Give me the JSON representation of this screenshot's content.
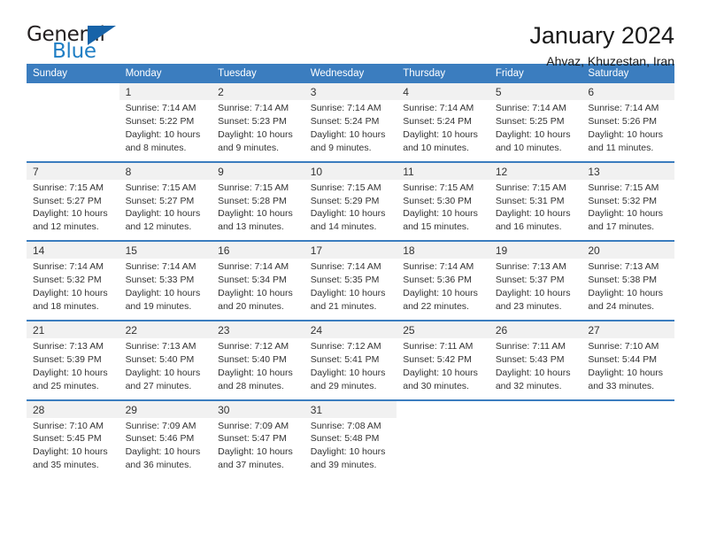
{
  "brand": {
    "name_part1": "General",
    "name_part2": "Blue",
    "triangle_icon": "triangle-icon",
    "primary_color": "#1763a8",
    "text_color": "#231f20"
  },
  "header": {
    "title": "January 2024",
    "subtitle": "Ahvaz, Khuzestan, Iran"
  },
  "theme": {
    "header_bar_color": "#3b7dbf",
    "daynum_band_color": "#f1f1f1",
    "separator_color": "#3b7dbf",
    "text_color": "#333333"
  },
  "weekday_headers": [
    "Sunday",
    "Monday",
    "Tuesday",
    "Wednesday",
    "Thursday",
    "Friday",
    "Saturday"
  ],
  "labels": {
    "sunrise_prefix": "Sunrise:",
    "sunset_prefix": "Sunset:",
    "daylight_prefix": "Daylight:"
  },
  "weeks": [
    {
      "days": [
        {
          "day": "",
          "sunrise": "",
          "sunset": "",
          "daylight_line1": "",
          "daylight_line2": "",
          "empty": true
        },
        {
          "day": "1",
          "sunrise": "Sunrise: 7:14 AM",
          "sunset": "Sunset: 5:22 PM",
          "daylight_line1": "Daylight: 10 hours",
          "daylight_line2": "and 8 minutes."
        },
        {
          "day": "2",
          "sunrise": "Sunrise: 7:14 AM",
          "sunset": "Sunset: 5:23 PM",
          "daylight_line1": "Daylight: 10 hours",
          "daylight_line2": "and 9 minutes."
        },
        {
          "day": "3",
          "sunrise": "Sunrise: 7:14 AM",
          "sunset": "Sunset: 5:24 PM",
          "daylight_line1": "Daylight: 10 hours",
          "daylight_line2": "and 9 minutes."
        },
        {
          "day": "4",
          "sunrise": "Sunrise: 7:14 AM",
          "sunset": "Sunset: 5:24 PM",
          "daylight_line1": "Daylight: 10 hours",
          "daylight_line2": "and 10 minutes."
        },
        {
          "day": "5",
          "sunrise": "Sunrise: 7:14 AM",
          "sunset": "Sunset: 5:25 PM",
          "daylight_line1": "Daylight: 10 hours",
          "daylight_line2": "and 10 minutes."
        },
        {
          "day": "6",
          "sunrise": "Sunrise: 7:14 AM",
          "sunset": "Sunset: 5:26 PM",
          "daylight_line1": "Daylight: 10 hours",
          "daylight_line2": "and 11 minutes."
        }
      ]
    },
    {
      "days": [
        {
          "day": "7",
          "sunrise": "Sunrise: 7:15 AM",
          "sunset": "Sunset: 5:27 PM",
          "daylight_line1": "Daylight: 10 hours",
          "daylight_line2": "and 12 minutes."
        },
        {
          "day": "8",
          "sunrise": "Sunrise: 7:15 AM",
          "sunset": "Sunset: 5:27 PM",
          "daylight_line1": "Daylight: 10 hours",
          "daylight_line2": "and 12 minutes."
        },
        {
          "day": "9",
          "sunrise": "Sunrise: 7:15 AM",
          "sunset": "Sunset: 5:28 PM",
          "daylight_line1": "Daylight: 10 hours",
          "daylight_line2": "and 13 minutes."
        },
        {
          "day": "10",
          "sunrise": "Sunrise: 7:15 AM",
          "sunset": "Sunset: 5:29 PM",
          "daylight_line1": "Daylight: 10 hours",
          "daylight_line2": "and 14 minutes."
        },
        {
          "day": "11",
          "sunrise": "Sunrise: 7:15 AM",
          "sunset": "Sunset: 5:30 PM",
          "daylight_line1": "Daylight: 10 hours",
          "daylight_line2": "and 15 minutes."
        },
        {
          "day": "12",
          "sunrise": "Sunrise: 7:15 AM",
          "sunset": "Sunset: 5:31 PM",
          "daylight_line1": "Daylight: 10 hours",
          "daylight_line2": "and 16 minutes."
        },
        {
          "day": "13",
          "sunrise": "Sunrise: 7:15 AM",
          "sunset": "Sunset: 5:32 PM",
          "daylight_line1": "Daylight: 10 hours",
          "daylight_line2": "and 17 minutes."
        }
      ]
    },
    {
      "days": [
        {
          "day": "14",
          "sunrise": "Sunrise: 7:14 AM",
          "sunset": "Sunset: 5:32 PM",
          "daylight_line1": "Daylight: 10 hours",
          "daylight_line2": "and 18 minutes."
        },
        {
          "day": "15",
          "sunrise": "Sunrise: 7:14 AM",
          "sunset": "Sunset: 5:33 PM",
          "daylight_line1": "Daylight: 10 hours",
          "daylight_line2": "and 19 minutes."
        },
        {
          "day": "16",
          "sunrise": "Sunrise: 7:14 AM",
          "sunset": "Sunset: 5:34 PM",
          "daylight_line1": "Daylight: 10 hours",
          "daylight_line2": "and 20 minutes."
        },
        {
          "day": "17",
          "sunrise": "Sunrise: 7:14 AM",
          "sunset": "Sunset: 5:35 PM",
          "daylight_line1": "Daylight: 10 hours",
          "daylight_line2": "and 21 minutes."
        },
        {
          "day": "18",
          "sunrise": "Sunrise: 7:14 AM",
          "sunset": "Sunset: 5:36 PM",
          "daylight_line1": "Daylight: 10 hours",
          "daylight_line2": "and 22 minutes."
        },
        {
          "day": "19",
          "sunrise": "Sunrise: 7:13 AM",
          "sunset": "Sunset: 5:37 PM",
          "daylight_line1": "Daylight: 10 hours",
          "daylight_line2": "and 23 minutes."
        },
        {
          "day": "20",
          "sunrise": "Sunrise: 7:13 AM",
          "sunset": "Sunset: 5:38 PM",
          "daylight_line1": "Daylight: 10 hours",
          "daylight_line2": "and 24 minutes."
        }
      ]
    },
    {
      "days": [
        {
          "day": "21",
          "sunrise": "Sunrise: 7:13 AM",
          "sunset": "Sunset: 5:39 PM",
          "daylight_line1": "Daylight: 10 hours",
          "daylight_line2": "and 25 minutes."
        },
        {
          "day": "22",
          "sunrise": "Sunrise: 7:13 AM",
          "sunset": "Sunset: 5:40 PM",
          "daylight_line1": "Daylight: 10 hours",
          "daylight_line2": "and 27 minutes."
        },
        {
          "day": "23",
          "sunrise": "Sunrise: 7:12 AM",
          "sunset": "Sunset: 5:40 PM",
          "daylight_line1": "Daylight: 10 hours",
          "daylight_line2": "and 28 minutes."
        },
        {
          "day": "24",
          "sunrise": "Sunrise: 7:12 AM",
          "sunset": "Sunset: 5:41 PM",
          "daylight_line1": "Daylight: 10 hours",
          "daylight_line2": "and 29 minutes."
        },
        {
          "day": "25",
          "sunrise": "Sunrise: 7:11 AM",
          "sunset": "Sunset: 5:42 PM",
          "daylight_line1": "Daylight: 10 hours",
          "daylight_line2": "and 30 minutes."
        },
        {
          "day": "26",
          "sunrise": "Sunrise: 7:11 AM",
          "sunset": "Sunset: 5:43 PM",
          "daylight_line1": "Daylight: 10 hours",
          "daylight_line2": "and 32 minutes."
        },
        {
          "day": "27",
          "sunrise": "Sunrise: 7:10 AM",
          "sunset": "Sunset: 5:44 PM",
          "daylight_line1": "Daylight: 10 hours",
          "daylight_line2": "and 33 minutes."
        }
      ]
    },
    {
      "days": [
        {
          "day": "28",
          "sunrise": "Sunrise: 7:10 AM",
          "sunset": "Sunset: 5:45 PM",
          "daylight_line1": "Daylight: 10 hours",
          "daylight_line2": "and 35 minutes."
        },
        {
          "day": "29",
          "sunrise": "Sunrise: 7:09 AM",
          "sunset": "Sunset: 5:46 PM",
          "daylight_line1": "Daylight: 10 hours",
          "daylight_line2": "and 36 minutes."
        },
        {
          "day": "30",
          "sunrise": "Sunrise: 7:09 AM",
          "sunset": "Sunset: 5:47 PM",
          "daylight_line1": "Daylight: 10 hours",
          "daylight_line2": "and 37 minutes."
        },
        {
          "day": "31",
          "sunrise": "Sunrise: 7:08 AM",
          "sunset": "Sunset: 5:48 PM",
          "daylight_line1": "Daylight: 10 hours",
          "daylight_line2": "and 39 minutes."
        },
        {
          "day": "",
          "sunrise": "",
          "sunset": "",
          "daylight_line1": "",
          "daylight_line2": "",
          "empty": true
        },
        {
          "day": "",
          "sunrise": "",
          "sunset": "",
          "daylight_line1": "",
          "daylight_line2": "",
          "empty": true
        },
        {
          "day": "",
          "sunrise": "",
          "sunset": "",
          "daylight_line1": "",
          "daylight_line2": "",
          "empty": true
        }
      ]
    }
  ]
}
